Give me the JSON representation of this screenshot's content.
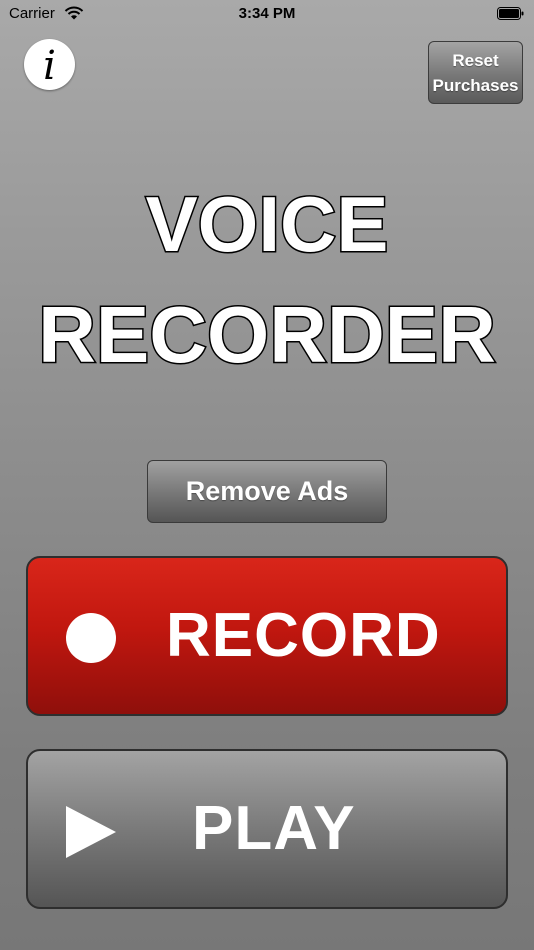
{
  "status_bar": {
    "carrier": "Carrier",
    "time": "3:34 PM",
    "wifi_icon": "wifi-icon",
    "battery_icon": "battery-icon"
  },
  "header": {
    "info_icon": "info-icon",
    "info_glyph": "i",
    "reset_button": [
      "Reset",
      "Purchases"
    ]
  },
  "title": {
    "line1": "VOICE",
    "line2": "RECORDER"
  },
  "remove_ads": {
    "label": "Remove Ads"
  },
  "record": {
    "label": "RECORD",
    "icon": "record-dot-icon"
  },
  "play": {
    "label": "PLAY",
    "icon": "play-icon"
  },
  "colors": {
    "record": "#c1170f",
    "button_gray": "#777777",
    "background": "#8a8a8a",
    "text": "#ffffff"
  }
}
